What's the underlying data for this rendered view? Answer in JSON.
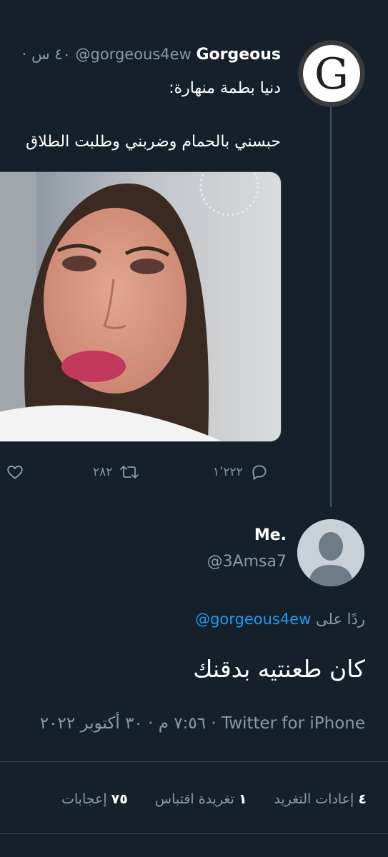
{
  "tweet": {
    "display_name": "Gorgeous",
    "handle": "@gorgeous4ew",
    "time": "· ٤٠ س",
    "line1": "دنيا بطمة منهارة:",
    "line2": "حبسني بالحمام وضربني وطلبت الطلاق",
    "avatar_letter": "G",
    "reply_count": "١٬٢٢٢",
    "retweet_count": "٢٨٢"
  },
  "reply": {
    "display_name": "Me.",
    "handle": "@3Amsa7",
    "replying_prefix": "ردًا على",
    "replying_handle": "@gorgeous4ew",
    "text": "كان طعنتيه بدقنك",
    "meta": "٧:٥٦ م · ٣٠ أكتوبر ٢٠٢٢ · Twitter for iPhone"
  },
  "stats": [
    {
      "count": "٤",
      "label": "إعادات التغريد"
    },
    {
      "count": "١",
      "label": "تغريدة اقتباس"
    },
    {
      "count": "٧٥",
      "label": "إعجابات"
    }
  ],
  "colors": {
    "background": "#15202b",
    "muted": "#8b98a5",
    "link": "#1d9bf0",
    "divider": "#38444d"
  },
  "icons": [
    "reply-icon",
    "retweet-icon",
    "like-icon",
    "default-avatar-icon"
  ]
}
